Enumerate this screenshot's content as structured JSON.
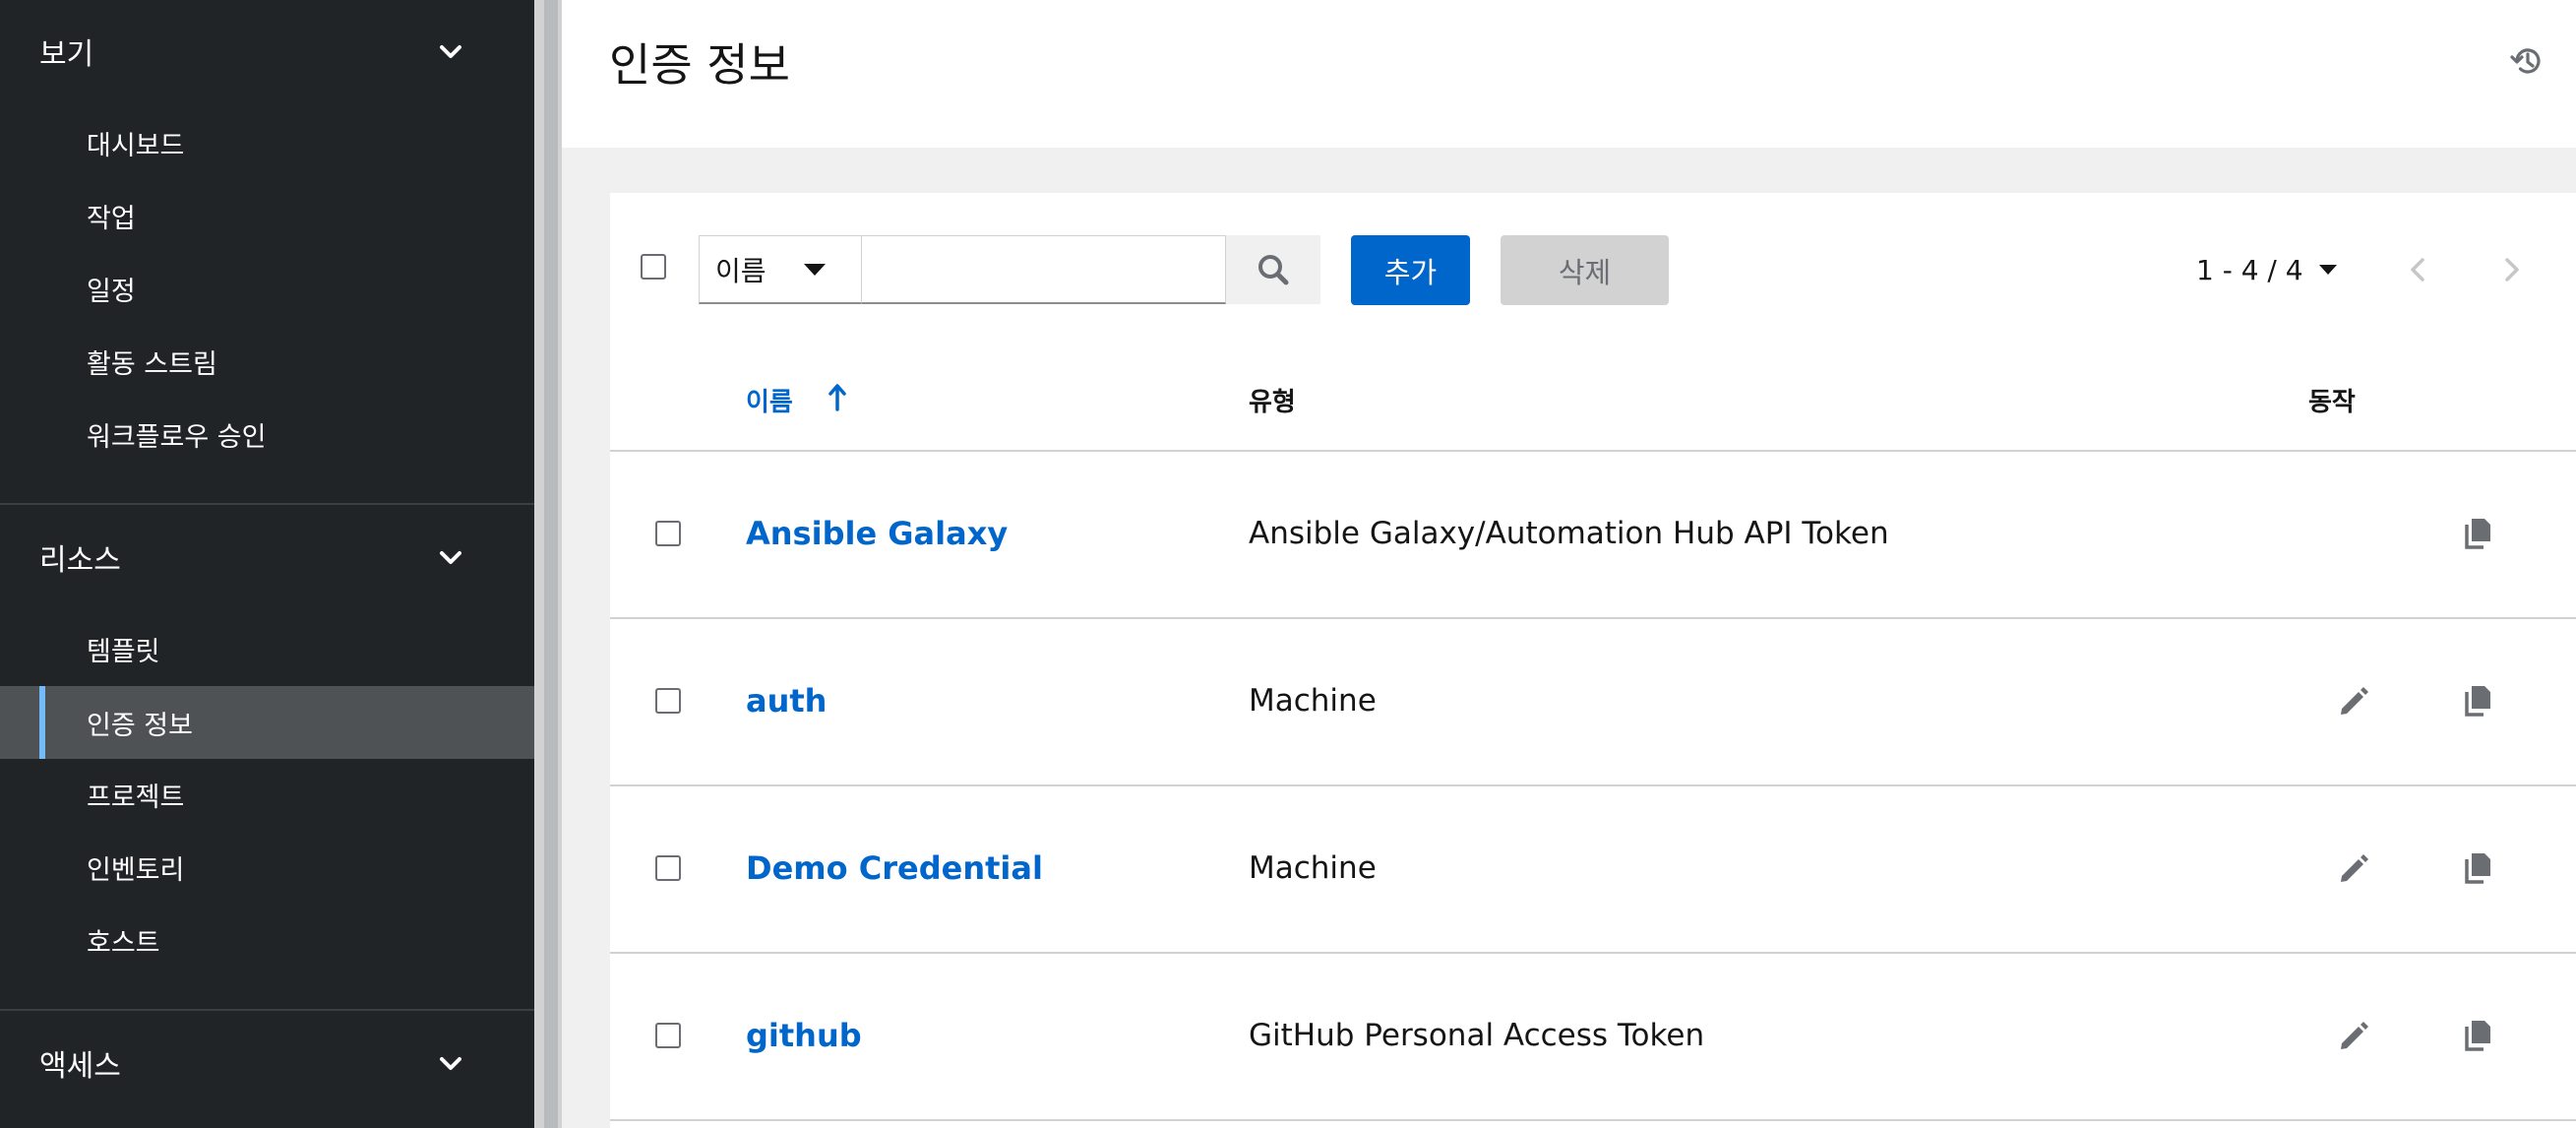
{
  "sidebar": {
    "groups": [
      {
        "label": "보기",
        "items": [
          "대시보드",
          "작업",
          "일정",
          "활동 스트림",
          "워크플로우 승인"
        ]
      },
      {
        "label": "리소스",
        "items": [
          "템플릿",
          "인증 정보",
          "프로젝트",
          "인벤토리",
          "호스트"
        ]
      },
      {
        "label": "액세스"
      }
    ],
    "active_item": "인증 정보"
  },
  "header": {
    "title": "인증 정보"
  },
  "toolbar": {
    "filter_label": "이름",
    "search_value": "",
    "add_label": "추가",
    "delete_label": "삭제",
    "pagination": "1 - 4 / 4"
  },
  "table": {
    "columns": [
      "이름",
      "유형",
      "동작"
    ],
    "rows": [
      {
        "name": "Ansible Galaxy",
        "type": "Ansible Galaxy/Automation Hub API Token"
      },
      {
        "name": "auth",
        "type": "Machine"
      },
      {
        "name": "Demo Credential",
        "type": "Machine"
      },
      {
        "name": "github",
        "type": "GitHub Personal Access Token"
      }
    ]
  },
  "colors": {
    "sidebar_bg": "#212427",
    "active_item_bg": "#4f5255",
    "active_indicator": "#73bcf7",
    "primary": "#0066cc",
    "link": "#0066cc"
  }
}
